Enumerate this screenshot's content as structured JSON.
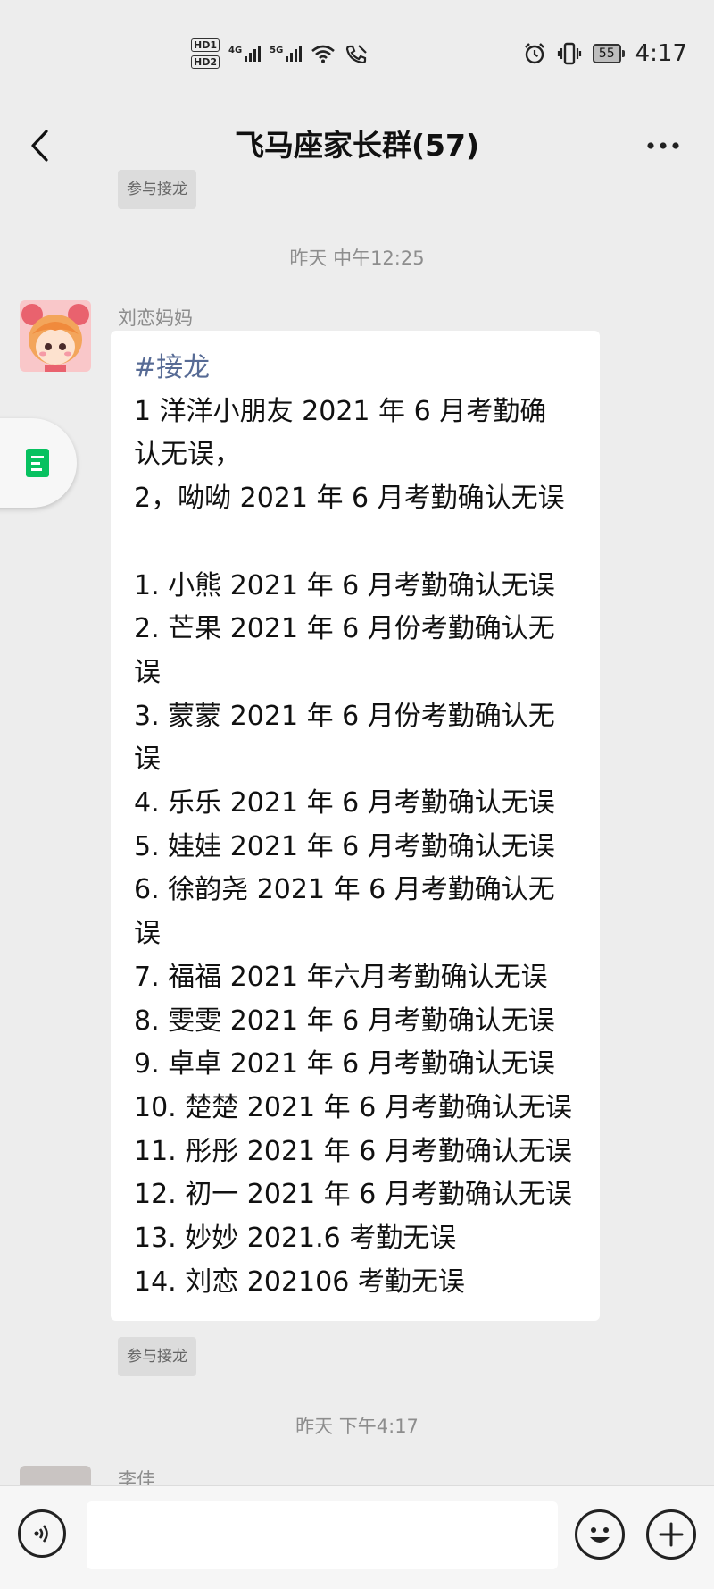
{
  "status_bar": {
    "hd1": "HD1",
    "hd2": "HD2",
    "net1": "4G",
    "net2": "5G",
    "battery": "55",
    "time": "4:17"
  },
  "header": {
    "title": "飞马座家长群(57)"
  },
  "chat": {
    "relay_button_top": "参与接龙",
    "timestamp1": "昨天 中午12:25",
    "sender": "刘恋妈妈",
    "message_tag": "#接龙",
    "message_lines": [
      "1 洋洋小朋友 2021 年 6 月考勤确",
      "认无误，",
      "2，呦呦 2021 年 6 月考勤确认无误",
      "",
      "1. 小熊 2021 年 6 月考勤确认无误",
      "2. 芒果 2021 年 6 月份考勤确认无",
      "误",
      "3. 蒙蒙 2021 年 6 月份考勤确认无",
      "误",
      "4. 乐乐 2021 年 6 月考勤确认无误",
      "5. 娃娃 2021 年 6 月考勤确认无误",
      "6. 徐韵尧 2021 年 6 月考勤确认无",
      "误",
      "7. 福福 2021 年六月考勤确认无误",
      "8. 雯雯 2021 年 6 月考勤确认无误",
      "9. 卓卓 2021 年 6 月考勤确认无误",
      "10. 楚楚 2021 年 6 月考勤确认无误",
      "11. 彤彤 2021 年 6 月考勤确认无误",
      "12. 初一 2021 年 6 月考勤确认无误",
      "13. 妙妙 2021.6 考勤无误",
      "14. 刘恋 202106 考勤无误"
    ],
    "relay_button_bottom": "参与接龙",
    "timestamp2": "昨天 下午4:17",
    "sender2": "李佳"
  },
  "colors": {
    "background": "#ededed",
    "bubble": "#ffffff",
    "tag_link": "#576b95",
    "doc_icon": "#07c160"
  }
}
